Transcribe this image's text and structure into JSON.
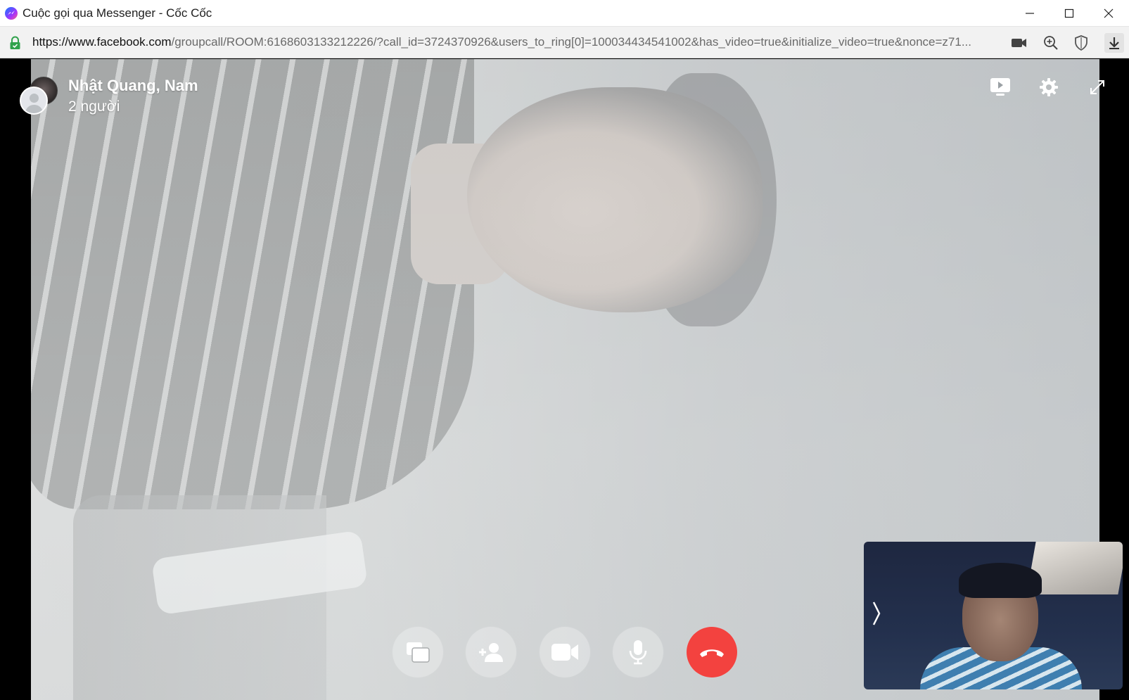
{
  "window": {
    "title": "Cuộc gọi qua Messenger - Cốc Cốc"
  },
  "addressbar": {
    "url_host": "https://www.facebook.com",
    "url_path": "/groupcall/ROOM:6168603133212226/?call_id=3724370926&users_to_ring[0]=100034434541002&has_video=true&initialize_video=true&nonce=z71..."
  },
  "call": {
    "participants_name": "Nhật Quang, Nam",
    "participants_count": "2 người",
    "controls": [
      {
        "name": "share-screen",
        "icon": "screens-icon"
      },
      {
        "name": "add-person",
        "icon": "add-person-icon"
      },
      {
        "name": "video-toggle",
        "icon": "video-camera-icon"
      },
      {
        "name": "mic-toggle",
        "icon": "microphone-icon"
      },
      {
        "name": "end-call",
        "icon": "hang-up-icon",
        "color": "#f3423f"
      }
    ]
  },
  "colors": {
    "end_call": "#f3423f",
    "secure_lock": "#31a24c"
  }
}
